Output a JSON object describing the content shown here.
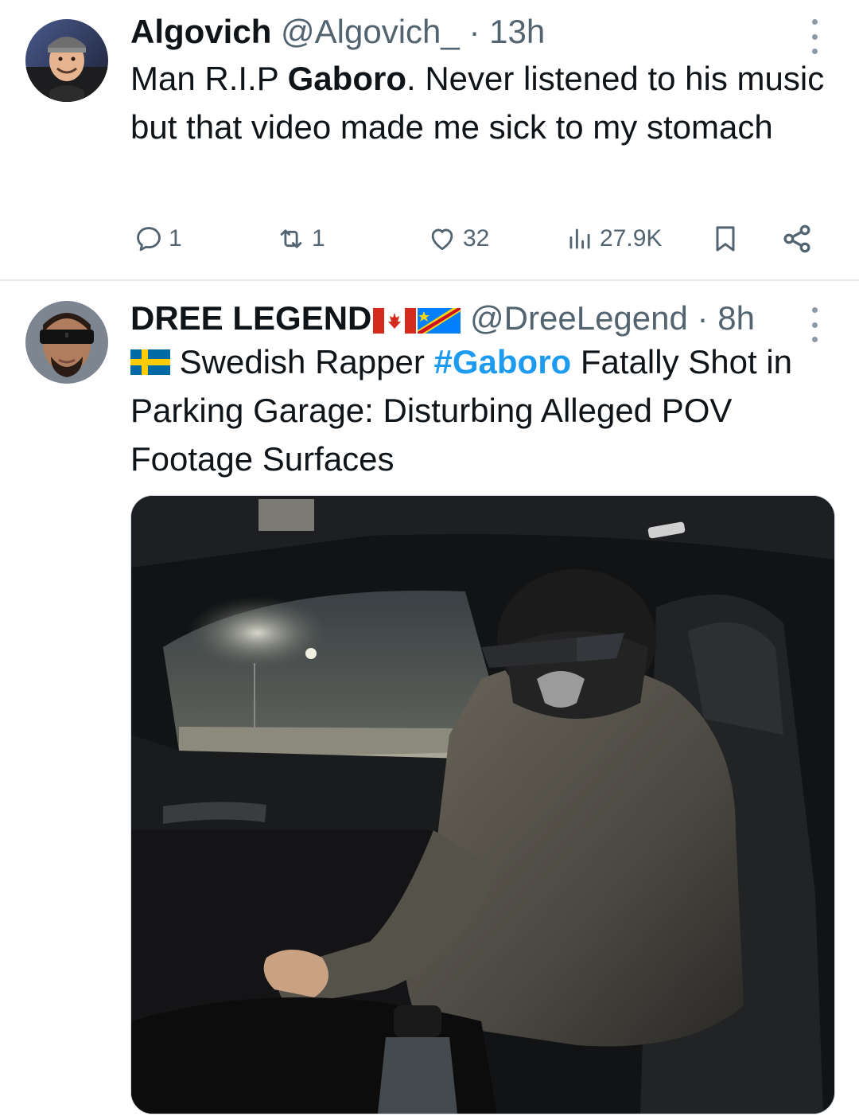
{
  "tweets": [
    {
      "author_name": "Algovich",
      "handle": "@Algovich_",
      "separator": "·",
      "time": "13h",
      "text": {
        "p1": "Man R.I.P ",
        "bold": "Gaboro",
        "p2": ". Never listened to his music but that video made me sick to my stomach"
      },
      "actions": {
        "replies": "1",
        "reposts": "1",
        "likes": "32",
        "views": "27.9K"
      }
    },
    {
      "author_name": "DREE LEGEND",
      "handle": "@DreeLegend",
      "separator": "·",
      "time": "8h",
      "text": {
        "p1": " Swedish Rapper ",
        "hashtag": "#Gaboro",
        "p2": " Fatally Shot in Parking Garage: Disturbing Alleged POV Footage Surfaces"
      }
    }
  ],
  "icons": {
    "reply": "reply-icon",
    "repost": "repost-icon",
    "like": "heart-icon",
    "views": "views-icon",
    "bookmark": "bookmark-icon",
    "share": "share-icon",
    "more": "more-vertical-icon"
  },
  "colors": {
    "text": "#0f1419",
    "secondary": "#536471",
    "accent": "#1d9bf0",
    "divider": "#e7e9ea"
  }
}
